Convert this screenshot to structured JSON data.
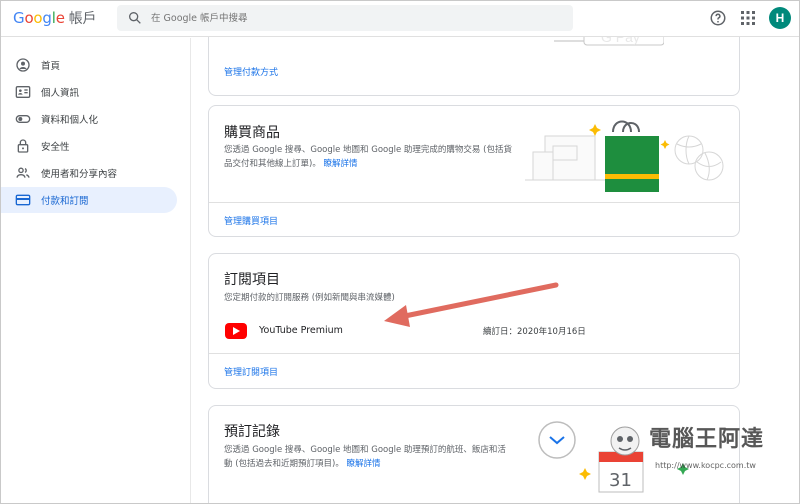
{
  "header": {
    "logo": {
      "letters": [
        "G",
        "o",
        "o",
        "g",
        "l",
        "e"
      ],
      "suffix": "帳戶"
    },
    "search_placeholder": "在 Google 帳戶中搜尋",
    "avatar_initial": "H"
  },
  "sidebar": {
    "items": [
      {
        "label": "首頁",
        "icon": "home-icon",
        "active": false
      },
      {
        "label": "個人資訊",
        "icon": "id-card-icon",
        "active": false
      },
      {
        "label": "資料和個人化",
        "icon": "toggle-icon",
        "active": false
      },
      {
        "label": "安全性",
        "icon": "lock-icon",
        "active": false
      },
      {
        "label": "使用者和分享內容",
        "icon": "people-icon",
        "active": false
      },
      {
        "label": "付款和訂閱",
        "icon": "credit-card-icon",
        "active": true
      }
    ]
  },
  "payment_methods": {
    "link": "管理付款方式"
  },
  "purchases": {
    "title": "購買商品",
    "description": "您透過 Google 搜尋、Google 地圖和 Google 助理完成的購物交易 (包括貨品交付和其他線上訂單)。",
    "more": "瞭解詳情",
    "link": "管理購買項目"
  },
  "subscriptions": {
    "title": "訂閱項目",
    "description": "您定期付款的訂閱服務 (例如新聞與串流媒體)",
    "item_name": "YouTube Premium",
    "renew_label": "續訂日：2020年10月16日",
    "link": "管理訂閱項目"
  },
  "reservations": {
    "title": "預訂記錄",
    "description": "您透過 Google 搜尋、Google 地圖和 Google 助理預訂的航班、飯店和活動 (包括過去和近期預訂項目)。",
    "more": "瞭解詳情"
  },
  "watermark": {
    "name": "電腦王阿達",
    "url": "http://www.kocpc.com.tw"
  },
  "colors": {
    "accent": "#1a73e8",
    "active_bg": "#e8f0fe",
    "arrow": "#e06b5f",
    "youtube": "#ff0000",
    "bag": "#1e8e3e"
  }
}
